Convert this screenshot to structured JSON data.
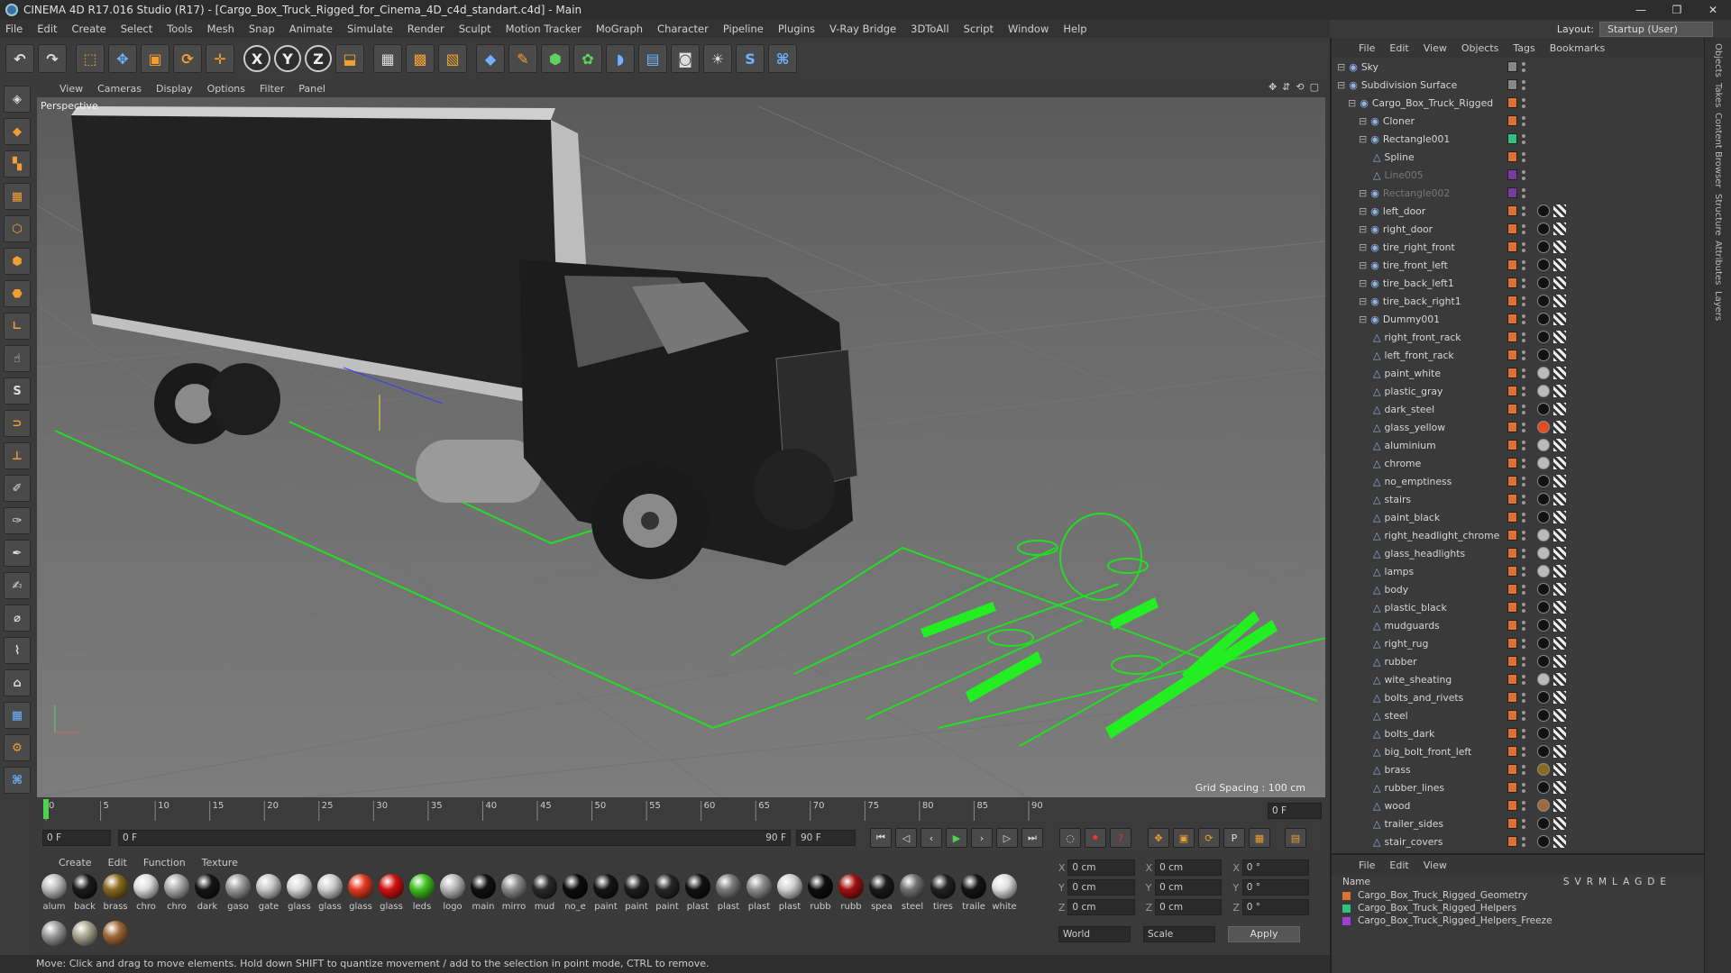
{
  "window": {
    "title": "CINEMA 4D R17.016 Studio (R17) - [Cargo_Box_Truck_Rigged_for_Cinema_4D_c4d_standart.c4d] - Main",
    "controls": [
      "—",
      "❐",
      "✕"
    ]
  },
  "menu": [
    "File",
    "Edit",
    "Create",
    "Select",
    "Tools",
    "Mesh",
    "Snap",
    "Animate",
    "Simulate",
    "Render",
    "Sculpt",
    "Motion Tracker",
    "MoGraph",
    "Character",
    "Pipeline",
    "Plugins",
    "V-Ray Bridge",
    "3DToAll",
    "Script",
    "Window",
    "Help"
  ],
  "layout": {
    "label": "Layout:",
    "value": "Startup (User)"
  },
  "toolbar": {
    "x": "X",
    "y": "Y",
    "z": "Z"
  },
  "viewport": {
    "menu": [
      "View",
      "Cameras",
      "Display",
      "Options",
      "Filter",
      "Panel"
    ],
    "label": "Perspective",
    "grid_spacing": "Grid Spacing : 100 cm"
  },
  "timeline": {
    "ticks": [
      "0",
      "5",
      "10",
      "15",
      "20",
      "25",
      "30",
      "35",
      "40",
      "45",
      "50",
      "55",
      "60",
      "65",
      "70",
      "75",
      "80",
      "85",
      "90"
    ],
    "end_field": "0 F"
  },
  "transport": {
    "start": "0 F",
    "range_start": "0 F",
    "range_end": "90 F",
    "max": "90 F"
  },
  "materials": {
    "menu": [
      "Create",
      "Edit",
      "Function",
      "Texture"
    ],
    "items": [
      {
        "label": "alum",
        "color": "#bdbdbd"
      },
      {
        "label": "back",
        "color": "#1a1a1a"
      },
      {
        "label": "brass",
        "color": "#8a6a20"
      },
      {
        "label": "chro",
        "color": "#dcdcdc"
      },
      {
        "label": "chro",
        "color": "#aaaaaa"
      },
      {
        "label": "dark",
        "color": "#151515"
      },
      {
        "label": "gaso",
        "color": "#9a9a9a"
      },
      {
        "label": "gate",
        "color": "#c8c8c8"
      },
      {
        "label": "glass",
        "color": "#d8d8d8"
      },
      {
        "label": "glass",
        "color": "#cfcfcf"
      },
      {
        "label": "glass",
        "color": "#e23a20"
      },
      {
        "label": "glass",
        "color": "#d01010"
      },
      {
        "label": "leds",
        "color": "#40c020"
      },
      {
        "label": "logo",
        "color": "#b8b8b8"
      },
      {
        "label": "main",
        "color": "#111111"
      },
      {
        "label": "mirro",
        "color": "#8a8a8a"
      },
      {
        "label": "mud",
        "color": "#2a2a2a"
      },
      {
        "label": "no_e",
        "color": "#0c0c0c"
      },
      {
        "label": "paint",
        "color": "#161616"
      },
      {
        "label": "paint",
        "color": "#1e1e1e"
      },
      {
        "label": "paint",
        "color": "#262626"
      },
      {
        "label": "plast",
        "color": "#111111"
      },
      {
        "label": "plast",
        "color": "#7a7a7a"
      },
      {
        "label": "plast",
        "color": "#8d8d8d"
      },
      {
        "label": "plast",
        "color": "#d0d0d0"
      },
      {
        "label": "rubb",
        "color": "#0d0d0d"
      },
      {
        "label": "rubb",
        "color": "#a01010"
      },
      {
        "label": "spea",
        "color": "#1a1a1a"
      },
      {
        "label": "steel",
        "color": "#707070"
      },
      {
        "label": "tires",
        "color": "#222222"
      },
      {
        "label": "traile",
        "color": "#161616"
      },
      {
        "label": "white",
        "color": "#dedede"
      },
      {
        "label": "",
        "color": "#9a9a9a"
      },
      {
        "label": "",
        "color": "#a8a890"
      },
      {
        "label": "",
        "color": "#a06a3a"
      }
    ]
  },
  "coords": {
    "rows": [
      [
        "X",
        "0 cm",
        "X",
        "0 cm",
        "X",
        "0 °"
      ],
      [
        "Y",
        "0 cm",
        "Y",
        "0 cm",
        "Y",
        "0 °"
      ],
      [
        "Z",
        "0 cm",
        "Z",
        "0 cm",
        "Z",
        "0 °"
      ]
    ],
    "world": "World",
    "scale": "Scale",
    "apply": "Apply"
  },
  "status": "Move: Click and drag to move elements. Hold down SHIFT to quantize movement / add to the selection in point mode, CTRL to remove.",
  "objects": {
    "menu": [
      "File",
      "Edit",
      "View",
      "Objects",
      "Tags",
      "Bookmarks"
    ],
    "rows": [
      {
        "name": "Sky",
        "indent": 0,
        "dim": false
      },
      {
        "name": "Subdivision Surface",
        "indent": 0,
        "dim": false
      },
      {
        "name": "Cargo_Box_Truck_Rigged",
        "indent": 1,
        "dim": false
      },
      {
        "name": "Cloner",
        "indent": 2,
        "dim": false
      },
      {
        "name": "Rectangle001",
        "indent": 2,
        "dim": false
      },
      {
        "name": "Spline",
        "indent": 3,
        "dim": false
      },
      {
        "name": "Line005",
        "indent": 3,
        "dim": true
      },
      {
        "name": "Rectangle002",
        "indent": 2,
        "dim": true
      },
      {
        "name": "left_door",
        "indent": 2,
        "dim": false
      },
      {
        "name": "right_door",
        "indent": 2,
        "dim": false
      },
      {
        "name": "tire_right_front",
        "indent": 2,
        "dim": false
      },
      {
        "name": "tire_front_left",
        "indent": 2,
        "dim": false
      },
      {
        "name": "tire_back_left1",
        "indent": 2,
        "dim": false
      },
      {
        "name": "tire_back_right1",
        "indent": 2,
        "dim": false
      },
      {
        "name": "Dummy001",
        "indent": 2,
        "dim": false
      },
      {
        "name": "right_front_rack",
        "indent": 3,
        "dim": false
      },
      {
        "name": "left_front_rack",
        "indent": 3,
        "dim": false
      },
      {
        "name": "paint_white",
        "indent": 3,
        "dim": false
      },
      {
        "name": "plastic_gray",
        "indent": 3,
        "dim": false
      },
      {
        "name": "dark_steel",
        "indent": 3,
        "dim": false
      },
      {
        "name": "glass_yellow",
        "indent": 3,
        "dim": false
      },
      {
        "name": "aluminium",
        "indent": 3,
        "dim": false
      },
      {
        "name": "chrome",
        "indent": 3,
        "dim": false
      },
      {
        "name": "no_emptiness",
        "indent": 3,
        "dim": false
      },
      {
        "name": "stairs",
        "indent": 3,
        "dim": false
      },
      {
        "name": "paint_black",
        "indent": 3,
        "dim": false
      },
      {
        "name": "right_headlight_chrome",
        "indent": 3,
        "dim": false
      },
      {
        "name": "glass_headlights",
        "indent": 3,
        "dim": false
      },
      {
        "name": "lamps",
        "indent": 3,
        "dim": false
      },
      {
        "name": "body",
        "indent": 3,
        "dim": false
      },
      {
        "name": "plastic_black",
        "indent": 3,
        "dim": false
      },
      {
        "name": "mudguards",
        "indent": 3,
        "dim": false
      },
      {
        "name": "right_rug",
        "indent": 3,
        "dim": false
      },
      {
        "name": "rubber",
        "indent": 3,
        "dim": false
      },
      {
        "name": "wite_sheating",
        "indent": 3,
        "dim": false
      },
      {
        "name": "bolts_and_rivets",
        "indent": 3,
        "dim": false
      },
      {
        "name": "steel",
        "indent": 3,
        "dim": false
      },
      {
        "name": "bolts_dark",
        "indent": 3,
        "dim": false
      },
      {
        "name": "big_bolt_front_left",
        "indent": 3,
        "dim": false
      },
      {
        "name": "brass",
        "indent": 3,
        "dim": false
      },
      {
        "name": "rubber_lines",
        "indent": 3,
        "dim": false
      },
      {
        "name": "wood",
        "indent": 3,
        "dim": false
      },
      {
        "name": "trailer_sides",
        "indent": 3,
        "dim": false
      },
      {
        "name": "stair_covers",
        "indent": 3,
        "dim": false
      }
    ]
  },
  "layers": {
    "menu": [
      "File",
      "Edit",
      "View"
    ],
    "header": "Name",
    "cols": [
      "S",
      "V",
      "R",
      "M",
      "L",
      "A",
      "G",
      "D",
      "E"
    ],
    "rows": [
      {
        "name": "Cargo_Box_Truck_Rigged_Geometry",
        "color": "#e07030"
      },
      {
        "name": "Cargo_Box_Truck_Rigged_Helpers",
        "color": "#30c080"
      },
      {
        "name": "Cargo_Box_Truck_Rigged_Helpers_Freeze",
        "color": "#a040d0"
      }
    ]
  },
  "side_tabs": [
    "Objects",
    "Takes",
    "Content Browser",
    "Structure",
    "Attributes",
    "Layers"
  ]
}
